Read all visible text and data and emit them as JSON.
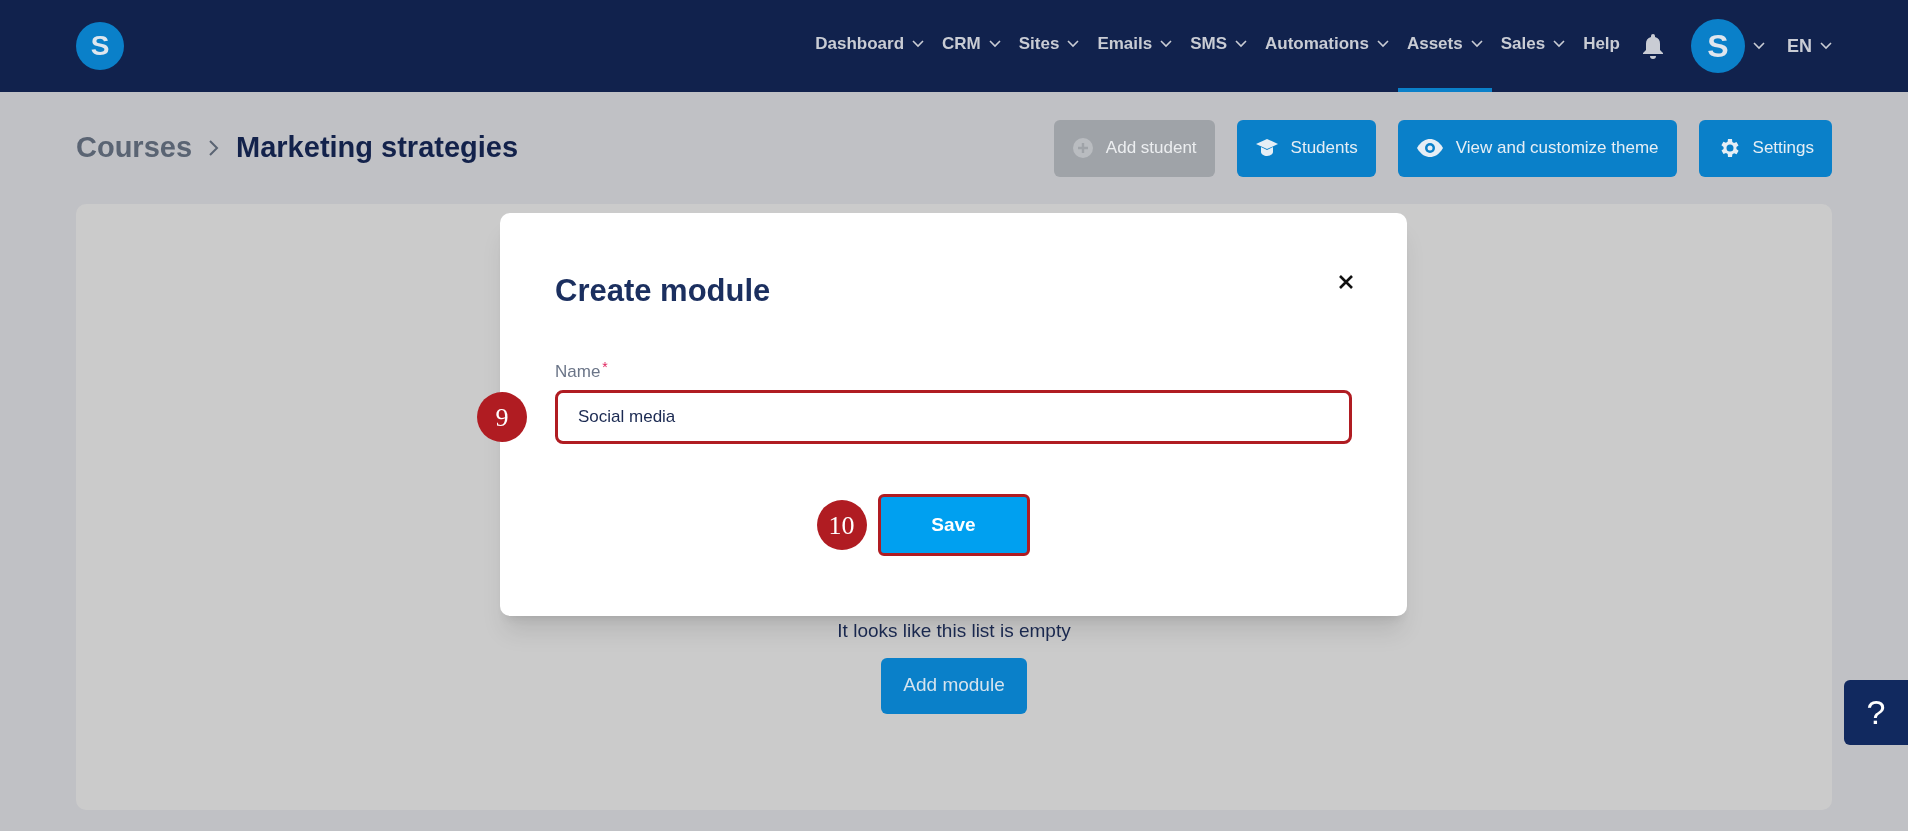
{
  "nav": {
    "logo": "S",
    "items": [
      {
        "label": "Dashboard",
        "dropdown": true,
        "selected": false
      },
      {
        "label": "CRM",
        "dropdown": true,
        "selected": false
      },
      {
        "label": "Sites",
        "dropdown": true,
        "selected": false
      },
      {
        "label": "Emails",
        "dropdown": true,
        "selected": false
      },
      {
        "label": "SMS",
        "dropdown": true,
        "selected": false
      },
      {
        "label": "Automations",
        "dropdown": true,
        "selected": false
      },
      {
        "label": "Assets",
        "dropdown": true,
        "selected": true
      },
      {
        "label": "Sales",
        "dropdown": true,
        "selected": false
      },
      {
        "label": "Help",
        "dropdown": false,
        "selected": false
      }
    ],
    "avatar": "S",
    "language": "EN"
  },
  "breadcrumb": [
    {
      "label": "Courses"
    },
    {
      "label": "Marketing strategies"
    }
  ],
  "actions": [
    {
      "label": "Add student",
      "kind": "plus",
      "disabled": true
    },
    {
      "label": "Students",
      "kind": "cap",
      "disabled": false
    },
    {
      "label": "View and customize theme",
      "kind": "eye",
      "disabled": false
    },
    {
      "label": "Settings",
      "kind": "gear",
      "disabled": false
    }
  ],
  "content": {
    "empty_text": "It looks like this list is empty",
    "button": "Add module"
  },
  "modal": {
    "title": "Create module",
    "field": {
      "label": "Name",
      "required_mark": "*",
      "value": "Social media",
      "badge": "9"
    },
    "save": {
      "label": "Save",
      "badge": "10"
    }
  },
  "help_button": "?"
}
